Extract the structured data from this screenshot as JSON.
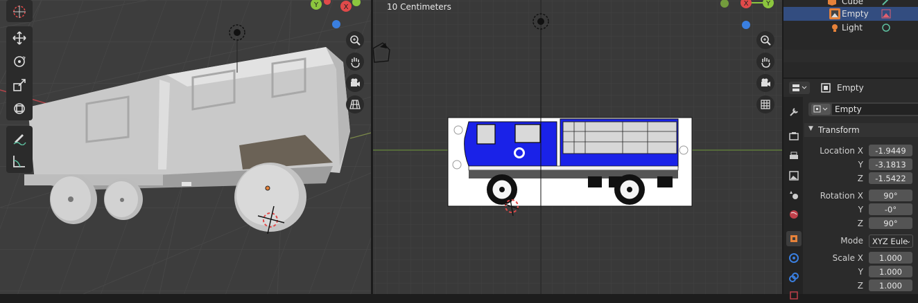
{
  "right_viewport": {
    "unit_label": "10 Centimeters"
  },
  "outliner": {
    "items": [
      {
        "label": "Cube"
      },
      {
        "label": "Empty"
      },
      {
        "label": "Light"
      }
    ]
  },
  "properties": {
    "header_object": "Empty",
    "object_name": "Empty",
    "section_title": "Transform",
    "location": {
      "label_x": "Location X",
      "label_y": "Y",
      "label_z": "Z",
      "x": "-1.9449",
      "y": "-3.1813",
      "z": "-1.5422"
    },
    "rotation": {
      "label_x": "Rotation X",
      "label_y": "Y",
      "label_z": "Z",
      "x": "90°",
      "y": "-0°",
      "z": "90°"
    },
    "mode": {
      "label": "Mode",
      "value": "XYZ Eule"
    },
    "scale": {
      "label_x": "Scale X",
      "label_y": "Y",
      "label_z": "Z",
      "x": "1.000",
      "y": "1.000",
      "z": "1.000"
    }
  },
  "colors": {
    "accent_orange": "#e6823a",
    "axis_red": "#e04a4a",
    "axis_green": "#8cc63e",
    "axis_blue": "#3a7fe0",
    "truck_blue": "#1a22e8"
  },
  "icons": {
    "left_toolbar": [
      "cursor-icon",
      "move-icon",
      "rotate-icon",
      "scale-icon",
      "transform-icon",
      "annotate-icon",
      "measure-icon"
    ],
    "nav": [
      "zoom-icon",
      "hand-icon",
      "camera-icon",
      "grid-icon"
    ]
  }
}
